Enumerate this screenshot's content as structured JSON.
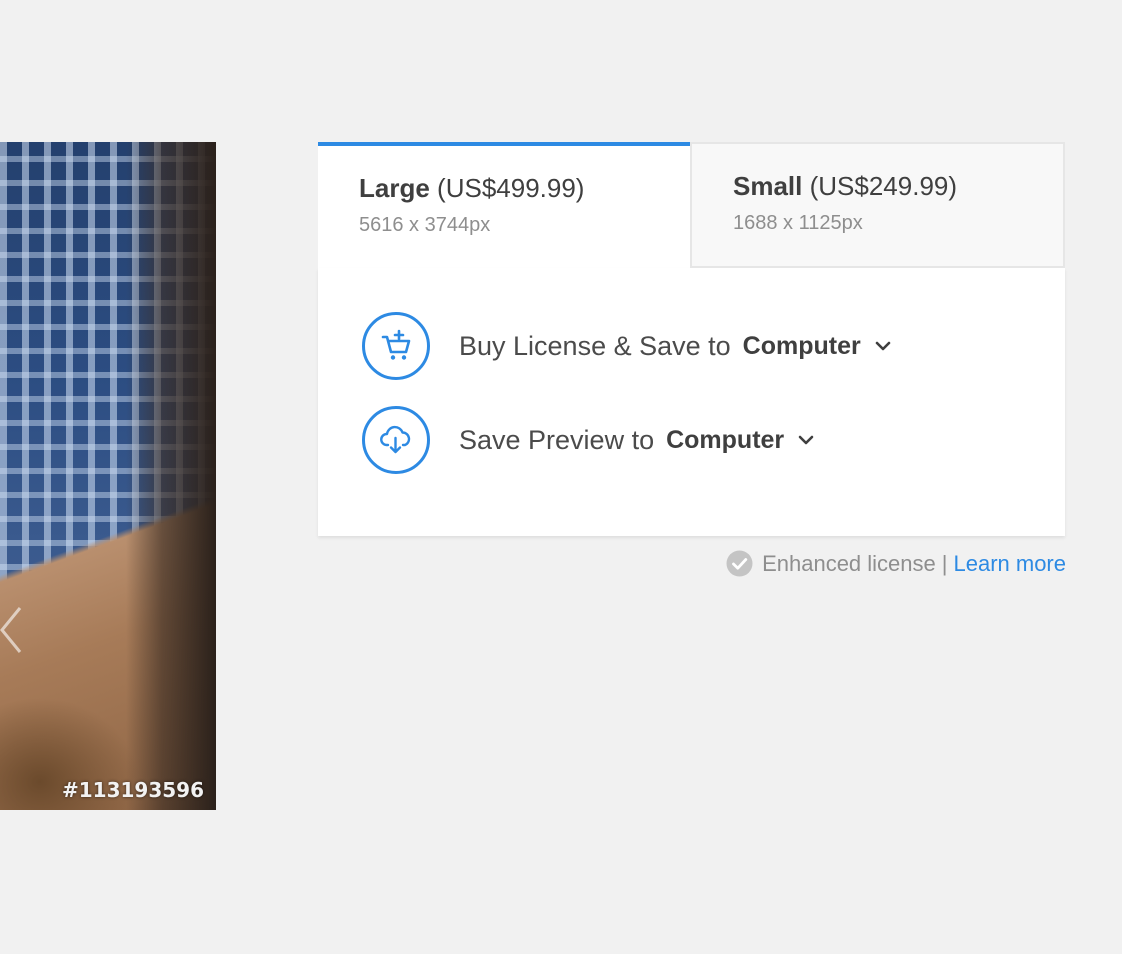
{
  "preview": {
    "image_id": "#113193596",
    "prev_icon": "chevron-left-icon"
  },
  "tabs": [
    {
      "size": "Large",
      "price": "(US$499.99)",
      "dimensions": "5616 x 3744px",
      "active": true
    },
    {
      "size": "Small",
      "price": "(US$249.99)",
      "dimensions": "1688 x 1125px",
      "active": false
    }
  ],
  "actions": {
    "buy": {
      "icon": "cart-add-icon",
      "label": "Buy License & Save to",
      "target": "Computer"
    },
    "preview": {
      "icon": "cloud-download-icon",
      "label": "Save Preview to",
      "target": "Computer"
    }
  },
  "license_note": {
    "icon": "check-circle-icon",
    "text": "Enhanced license",
    "separator": "|",
    "link": "Learn more"
  },
  "colors": {
    "accent": "#2d8ae3",
    "background": "#f1f1f1",
    "muted_text": "#8e8e8e"
  }
}
